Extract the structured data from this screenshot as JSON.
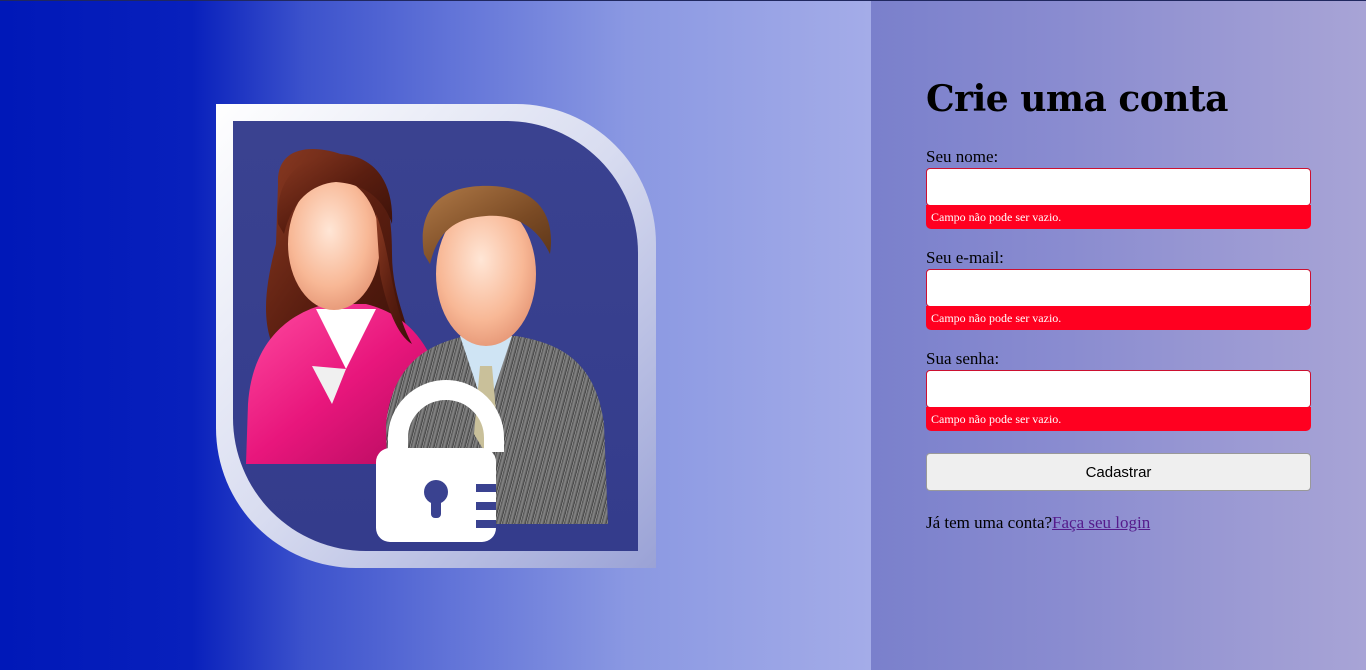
{
  "form": {
    "title": "Crie uma conta",
    "name_label": "Seu nome:",
    "name_value": "",
    "name_error": "Campo não pode ser vazio.",
    "email_label": "Seu e-mail:",
    "email_value": "",
    "email_error": "Campo não pode ser vazio.",
    "password_label": "Sua senha:",
    "password_value": "",
    "password_error": "Campo não pode ser vazio.",
    "submit_label": "Cadastrar",
    "login_prompt": "Já tem uma conta?",
    "login_link": "Faça seu login"
  },
  "illustration": {
    "icon": "users-lock-icon"
  },
  "colors": {
    "error_bg": "#ff0020",
    "link": "#551a8b",
    "left_gradient_start": "#0018b8",
    "right_gradient_end": "#a8a4d6"
  }
}
